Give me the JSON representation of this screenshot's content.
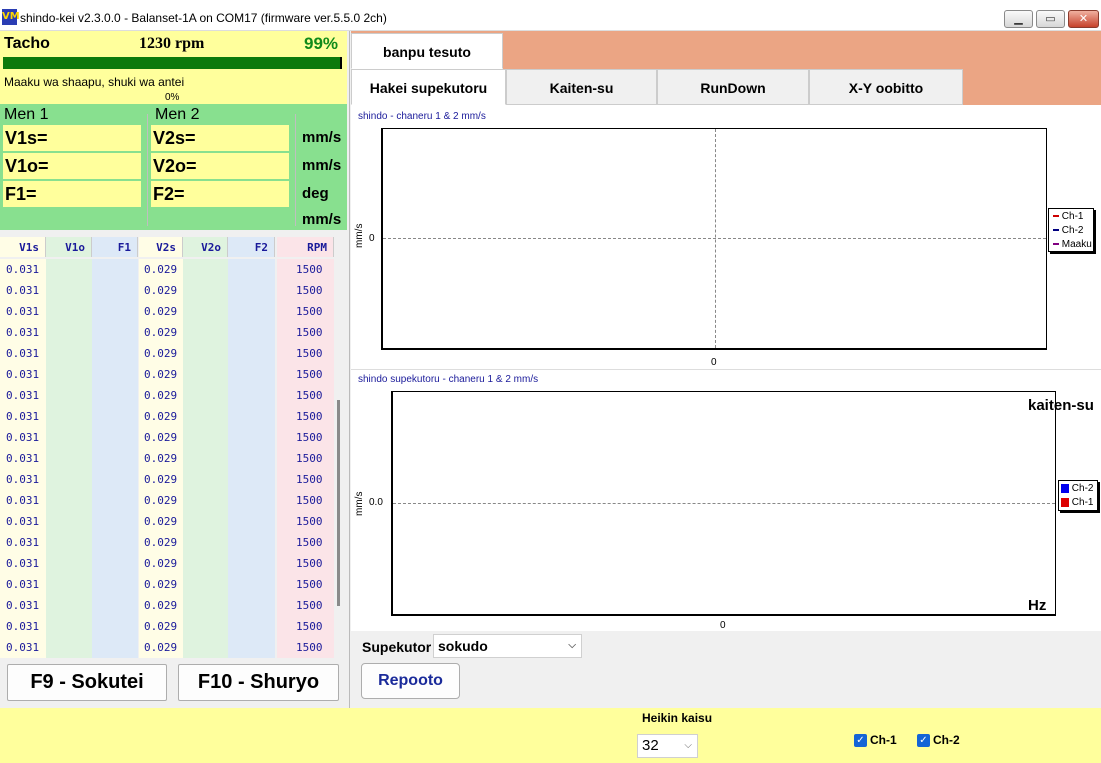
{
  "window": {
    "title": "shindo-kei v2.3.0.0 - Balanset-1A on COM17 (firmware ver.5.5.0 2ch)",
    "icon_text": "VM"
  },
  "tacho": {
    "label": "Tacho",
    "rpm": "1230 rpm",
    "percent": "99%",
    "status": "Maaku wa shaapu, shuki wa antei",
    "progress_text": "0%",
    "bar_fraction": 0.99
  },
  "planes": {
    "plane1": {
      "label": "Men 1",
      "v1s": "V1s=",
      "v1o": "V1o=",
      "f1": "F1="
    },
    "plane2": {
      "label": "Men 2",
      "v2s": "V2s=",
      "v2o": "V2o=",
      "f2": "F2="
    },
    "units": [
      "mm/s",
      "mm/s",
      "deg",
      "mm/s"
    ]
  },
  "grid": {
    "headers": [
      "V1s",
      "V1o",
      "F1",
      "V2s",
      "V2o",
      "F2",
      "RPM"
    ],
    "rows": [
      [
        "0.031",
        "",
        "",
        "0.029",
        "",
        "",
        "1500"
      ],
      [
        "0.031",
        "",
        "",
        "0.029",
        "",
        "",
        "1500"
      ],
      [
        "0.031",
        "",
        "",
        "0.029",
        "",
        "",
        "1500"
      ],
      [
        "0.031",
        "",
        "",
        "0.029",
        "",
        "",
        "1500"
      ],
      [
        "0.031",
        "",
        "",
        "0.029",
        "",
        "",
        "1500"
      ],
      [
        "0.031",
        "",
        "",
        "0.029",
        "",
        "",
        "1500"
      ],
      [
        "0.031",
        "",
        "",
        "0.029",
        "",
        "",
        "1500"
      ],
      [
        "0.031",
        "",
        "",
        "0.029",
        "",
        "",
        "1500"
      ],
      [
        "0.031",
        "",
        "",
        "0.029",
        "",
        "",
        "1500"
      ],
      [
        "0.031",
        "",
        "",
        "0.029",
        "",
        "",
        "1500"
      ],
      [
        "0.031",
        "",
        "",
        "0.029",
        "",
        "",
        "1500"
      ],
      [
        "0.031",
        "",
        "",
        "0.029",
        "",
        "",
        "1500"
      ],
      [
        "0.031",
        "",
        "",
        "0.029",
        "",
        "",
        "1500"
      ],
      [
        "0.031",
        "",
        "",
        "0.029",
        "",
        "",
        "1500"
      ],
      [
        "0.031",
        "",
        "",
        "0.029",
        "",
        "",
        "1500"
      ],
      [
        "0.031",
        "",
        "",
        "0.029",
        "",
        "",
        "1500"
      ],
      [
        "0.031",
        "",
        "",
        "0.029",
        "",
        "",
        "1500"
      ],
      [
        "0.031",
        "",
        "",
        "0.029",
        "",
        "",
        "1500"
      ],
      [
        "0.031",
        "",
        "",
        "0.029",
        "",
        "",
        "1500"
      ]
    ]
  },
  "buttons": {
    "measure": "F9 - Sokutei",
    "stop": "F10 - Shuryo",
    "report": "Repooto"
  },
  "tabs": {
    "top": "banpu tesuto",
    "row": [
      "Hakei supekutoru",
      "Kaiten-su",
      "RunDown",
      "X-Y oobitto"
    ]
  },
  "chart1": {
    "title": "shindo  - chaneru 1 & 2 mm/s",
    "ylabel": "mm/s",
    "ytick": "0",
    "xtick": "0",
    "legend": [
      {
        "name": "Ch-1",
        "color": "#cc0000"
      },
      {
        "name": "Ch-2",
        "color": "#000080"
      },
      {
        "name": "Maaku",
        "color": "#800080"
      }
    ]
  },
  "chart2": {
    "title": "shindo supekutoru  - chaneru 1 & 2 mm/s",
    "ylabel": "mm/s",
    "ytick": "0.0",
    "xtick": "0",
    "corner_top": "kaiten-su",
    "corner_bottom": "Hz",
    "legend": [
      {
        "name": "Ch-2",
        "color": "#0000ee"
      },
      {
        "name": "Ch-1",
        "color": "#dd0000"
      }
    ]
  },
  "spectrum": {
    "label": "Supekutor",
    "value": "sokudo"
  },
  "averaging": {
    "label": "Heikin kaisu",
    "value": "32"
  },
  "channels": [
    {
      "label": "Ch-1",
      "checked": true
    },
    {
      "label": "Ch-2",
      "checked": true
    }
  ]
}
